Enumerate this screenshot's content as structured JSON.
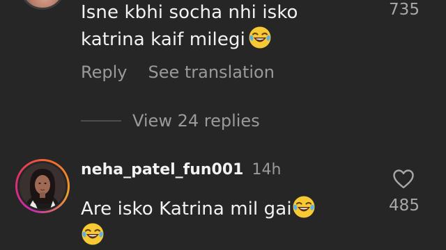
{
  "comment_prev": {
    "text": "Isne kbhi socha nhi isko katrina kaif milegi",
    "emoji": "face-with-tears-of-joy",
    "likes": "735",
    "actions": {
      "reply": "Reply",
      "see_translation": "See translation"
    },
    "view_replies": "View 24 replies"
  },
  "comment_next": {
    "username": "neha_patel_fun001",
    "time": "14h",
    "text_line1": "Are isko Katrina mil gai",
    "emoji": "face-with-tears-of-joy",
    "likes": "485",
    "like_icon": "heart-outline-icon"
  },
  "colors": {
    "background": "#262626",
    "primary_text": "#f2f2f2",
    "secondary_text": "#9a9a9a"
  }
}
